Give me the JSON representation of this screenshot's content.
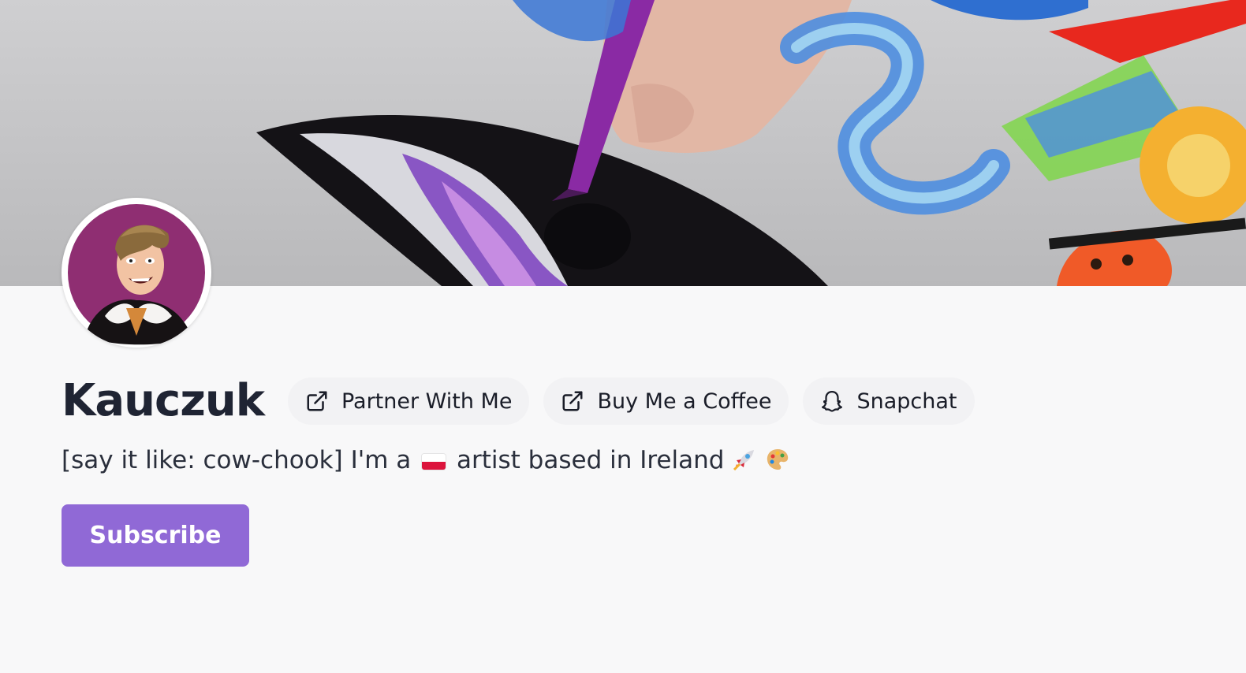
{
  "profile": {
    "name": "Kauczuk",
    "bio_prefix": "[say it like: cow-chook] I'm a",
    "bio_suffix": "artist based in Ireland",
    "flag_icon": "poland-flag-icon",
    "bio_emojis": [
      "rocket-icon",
      "palette-icon"
    ]
  },
  "links": [
    {
      "label": "Partner With Me",
      "icon": "external-link-icon"
    },
    {
      "label": "Buy Me a Coffee",
      "icon": "external-link-icon"
    },
    {
      "label": "Snapchat",
      "icon": "snapchat-ghost-icon"
    }
  ],
  "subscribe": {
    "label": "Subscribe"
  },
  "colors": {
    "accent": "#9069d6",
    "background": "#f8f8f9",
    "text": "#1f2433",
    "pill": "#f2f2f4"
  }
}
